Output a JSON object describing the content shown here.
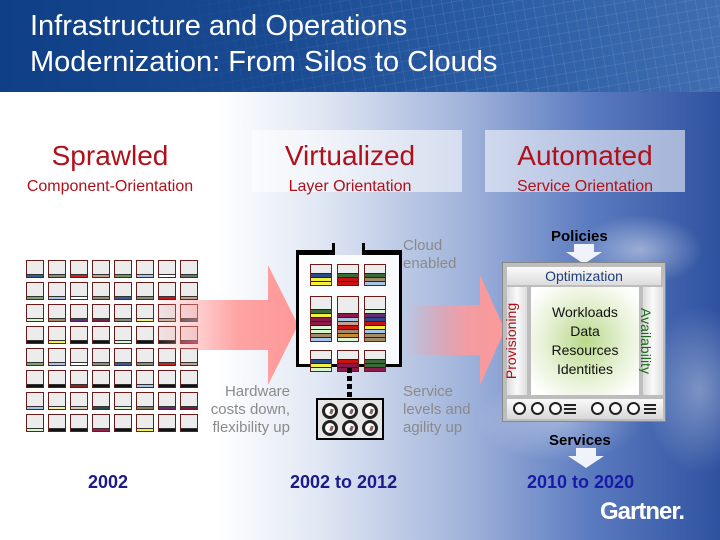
{
  "title": {
    "line1": "Infrastructure and Operations",
    "line2": "Modernization: From Silos to Clouds"
  },
  "stages": [
    {
      "name": "Sprawled",
      "orientation": "Component-Orientation",
      "period": "2002"
    },
    {
      "name": "Virtualized",
      "orientation": "Layer Orientation",
      "period": "2002 to 2012"
    },
    {
      "name": "Automated",
      "orientation": "Service Orientation",
      "period": "2010 to 2020"
    }
  ],
  "transitions": {
    "first": {
      "line1": "Hardware",
      "line2": "costs down,",
      "line3": "flexibility up"
    },
    "second": {
      "line1": "Service",
      "line2": "levels and",
      "line3": "agility up"
    },
    "cloud": {
      "line1": "Cloud",
      "line2": "enabled"
    }
  },
  "automated": {
    "input": "Policies",
    "top": "Optimization",
    "left": "Provisioning",
    "right": "Availability",
    "core": [
      "Workloads",
      "Data",
      "Resources",
      "Identities"
    ],
    "output": "Services"
  },
  "sprawled_grid": {
    "rows": 8,
    "cols": 8,
    "stripe_colors": [
      [
        "#3b5a9a",
        "#8a8a7a",
        "#cc2222",
        "#c8a08a",
        "#6a9a5a",
        "#a8c4e8",
        "#ffffff",
        "#6a7a6a"
      ],
      [
        "#7aa86a",
        "#a8c4e8",
        "#ffffff",
        "#9a8a7a",
        "#3b5a9a",
        "#8a8a7a",
        "#cc1111",
        "#c8a08a"
      ],
      [
        "#d8f4d0",
        "#a08a6a",
        "#6a2a7a",
        "#7a2244",
        "#8a8a7a",
        "#f4f080",
        "#c8b89a",
        "#2a4a4a"
      ],
      [
        "#111111",
        "#f4f040",
        "#111111",
        "#111111",
        "#d8f4d0",
        "#111111",
        "#111111",
        "#8a1a4a"
      ],
      [
        "#7aa86a",
        "#a8c4e8",
        "#ffffff",
        "#9a8a7a",
        "#3b5a9a",
        "#8a8a7a",
        "#cc2222",
        "#c8a08a"
      ],
      [
        "#111111",
        "#111111",
        "#8a2222",
        "#111111",
        "#111111",
        "#a8c4e8",
        "#111111",
        "#111111"
      ],
      [
        "#a8c4e8",
        "#f4f0a0",
        "#d8c8b0",
        "#2a4a4a",
        "#d8f4d0",
        "#8a7a5a",
        "#6a2a6a",
        "#7a1a3a"
      ],
      [
        "#d8f4d0",
        "#111111",
        "#111111",
        "#a01a4a",
        "#111111",
        "#f4f040",
        "#111111",
        "#111111"
      ]
    ]
  },
  "virtualized_stacks": {
    "bands": [
      [
        "#2a4a8a",
        "#f4f040",
        "#f4f040"
      ],
      [
        "#3a6a3a",
        "#cc1111",
        "#cc1111"
      ],
      [
        "#3a6a3a",
        "#a08a6a",
        "#a8c4e8"
      ],
      [
        "#3a6a3a",
        "#f4f040",
        "#8a1a4a",
        "#8a1a4a",
        "#d8f4d0",
        "#d8f4d0",
        "#a08a6a",
        "#a8c4e8"
      ],
      [
        "#8a1a4a",
        "#a8c4e8",
        "#c8a08a",
        "#cc1111",
        "#a08a6a",
        "#c88a2a",
        "#d8f4d0"
      ],
      [
        "#d8f4d0",
        "#6a2a7a",
        "#2a4a8a",
        "#cc1111",
        "#f4f040",
        "#a8c4e8",
        "#a08a6a",
        "#a08a6a"
      ],
      [
        "#2a4a8a",
        "#f4f040",
        "#d8f4d0"
      ],
      [
        "#cc1111",
        "#8a1a4a",
        "#8a1a4a"
      ],
      [
        "#3a6a3a",
        "#3a6a3a",
        "#8a1a4a"
      ]
    ]
  },
  "colors": {
    "accent_red": "#b0101a",
    "year_blue": "#1a1a8a",
    "header_blue": "#1a4b92",
    "arrow_pink": "#ff9999"
  },
  "logo": "Gartner."
}
